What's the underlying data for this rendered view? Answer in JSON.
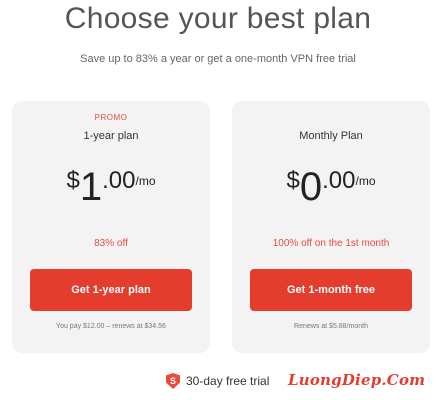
{
  "header": {
    "title": "Choose your best plan",
    "subtitle": "Save up to 83% a year or get a one-month VPN free trial"
  },
  "plans": [
    {
      "promo": "PROMO",
      "name": "1-year plan",
      "price_currency": "$",
      "price_int": "1",
      "price_dec": ".00",
      "price_period": "/mo",
      "discount": "83% off",
      "button_label": "Get 1-year plan",
      "footnote": "You pay $12.00 – renews at $34.56"
    },
    {
      "name": "Monthly Plan",
      "price_currency": "$",
      "price_int": "0",
      "price_dec": ".00",
      "price_period": "/mo",
      "discount": "100% off on the 1st month",
      "button_label": "Get 1-month free",
      "footnote": "Renews at $5.88/month"
    }
  ],
  "trial": {
    "shield_letter": "S",
    "icon": "shield-icon",
    "label": "30-day free trial"
  },
  "watermark": "LuongDiep.Com",
  "colors": {
    "accent": "#e43d2e",
    "card_bg": "#f3f3f4"
  }
}
